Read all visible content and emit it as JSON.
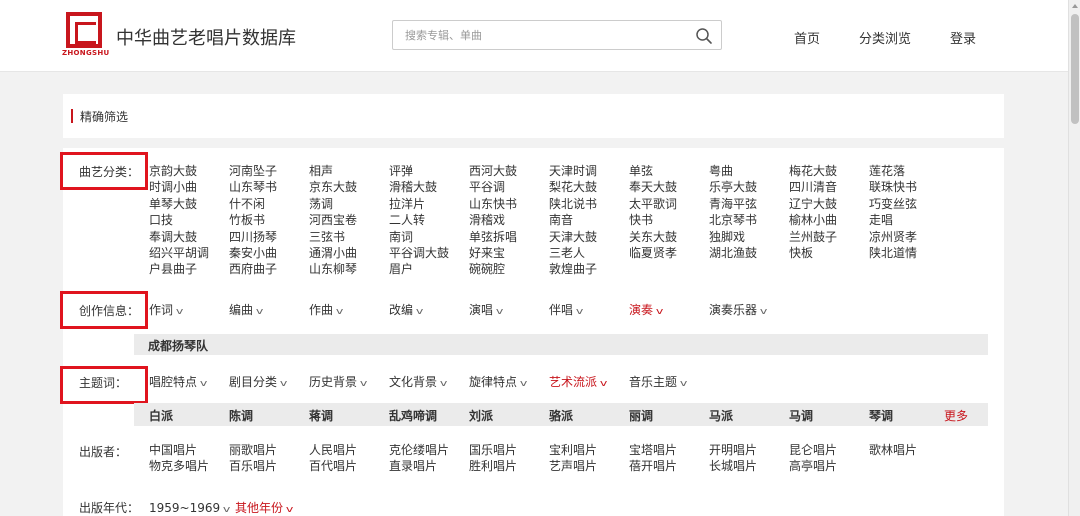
{
  "header": {
    "logo_text": "ZHONGSHU",
    "site_title": "中华曲艺老唱片数据库",
    "search_placeholder": "搜索专辑、单曲",
    "nav": [
      "首页",
      "分类浏览",
      "登录"
    ]
  },
  "filter_title": "精确筛选",
  "genre": {
    "label": "曲艺分类：",
    "columns": [
      [
        "京韵大鼓",
        "时调小曲",
        "单琴大鼓",
        "口技",
        "奉调大鼓",
        "绍兴平胡调",
        "户县曲子"
      ],
      [
        "河南坠子",
        "山东琴书",
        "什不闲",
        "竹板书",
        "四川扬琴",
        "秦安小曲",
        "西府曲子"
      ],
      [
        "相声",
        "京东大鼓",
        "荡调",
        "河西宝卷",
        "三弦书",
        "通渭小曲",
        "山东柳琴"
      ],
      [
        "评弹",
        "滑稽大鼓",
        "拉洋片",
        "二人转",
        "南词",
        "平谷调大鼓",
        "眉户"
      ],
      [
        "西河大鼓",
        "平谷调",
        "山东快书",
        "滑稽戏",
        "单弦拆唱",
        "好来宝",
        "碗碗腔"
      ],
      [
        "天津时调",
        "梨花大鼓",
        "陕北说书",
        "南音",
        "天津大鼓",
        "三老人",
        "敦煌曲子"
      ],
      [
        "单弦",
        "奉天大鼓",
        "太平歌词",
        "快书",
        "关东大鼓",
        "临夏贤孝"
      ],
      [
        "粤曲",
        "乐亭大鼓",
        "青海平弦",
        "北京琴书",
        "独脚戏",
        "湖北渔鼓"
      ],
      [
        "梅花大鼓",
        "四川清音",
        "辽宁大鼓",
        "榆林小曲",
        "兰州鼓子",
        "快板"
      ],
      [
        "莲花落",
        "联珠快书",
        "巧变丝弦",
        "走唱",
        "凉州贤孝",
        "陕北道情"
      ]
    ]
  },
  "creation": {
    "label": "创作信息：",
    "items": [
      "作词",
      "编曲",
      "作曲",
      "改编",
      "演唱",
      "伴唱",
      "演奏",
      "演奏乐器"
    ],
    "active_index": 6,
    "selected_bar": "成都扬琴队"
  },
  "theme": {
    "label": "主题词：",
    "items": [
      "唱腔特点",
      "剧目分类",
      "历史背景",
      "文化背景",
      "旋律特点",
      "艺术流派",
      "音乐主题"
    ],
    "active_index": 5,
    "schools": [
      "白派",
      "陈调",
      "蒋调",
      "乱鸡啼调",
      "刘派",
      "骆派",
      "丽调",
      "马派",
      "马调",
      "琴调"
    ],
    "more": "更多"
  },
  "publisher": {
    "label": "出版者：",
    "columns": [
      [
        "中国唱片",
        "物克多唱片"
      ],
      [
        "丽歌唱片",
        "百乐唱片"
      ],
      [
        "人民唱片",
        "百代唱片"
      ],
      [
        "克伦缕唱片",
        "直录唱片"
      ],
      [
        "国乐唱片",
        "胜利唱片"
      ],
      [
        "宝利唱片",
        "艺声唱片"
      ],
      [
        "宝塔唱片",
        "蓓开唱片"
      ],
      [
        "开明唱片",
        "长城唱片"
      ],
      [
        "昆仑唱片",
        "高亭唱片"
      ],
      [
        "歌林唱片"
      ]
    ]
  },
  "year": {
    "label": "出版年代：",
    "value": "1959~1969",
    "other": "其他年份"
  },
  "colors": {
    "accent": "#c8161d",
    "highlight_box": "#e0141e",
    "band": "#ebebeb",
    "background": "#f2f2f2"
  },
  "icons": {
    "search": "search-icon",
    "chevron": "chevron-down-icon"
  }
}
